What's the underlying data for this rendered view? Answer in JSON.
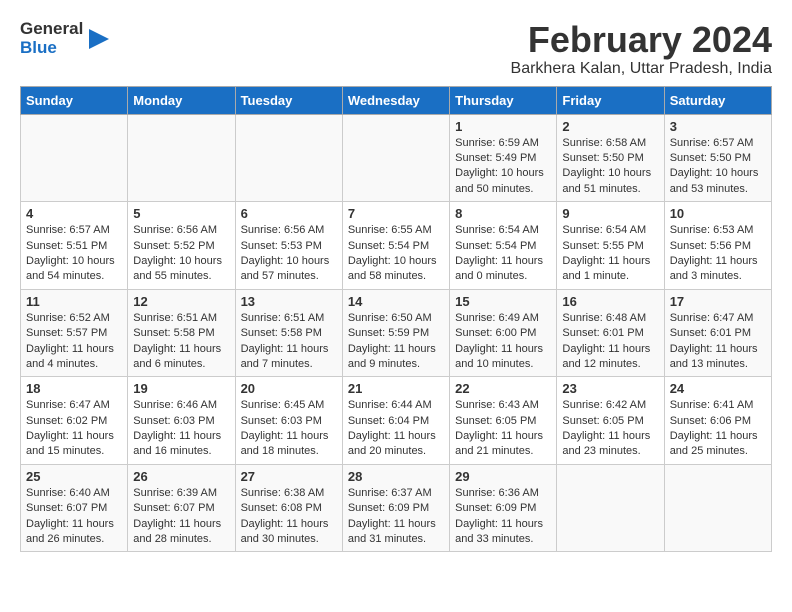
{
  "logo": {
    "line1": "General",
    "line2": "Blue"
  },
  "title": "February 2024",
  "subtitle": "Barkhera Kalan, Uttar Pradesh, India",
  "headers": [
    "Sunday",
    "Monday",
    "Tuesday",
    "Wednesday",
    "Thursday",
    "Friday",
    "Saturday"
  ],
  "rows": [
    [
      {
        "day": "",
        "info": ""
      },
      {
        "day": "",
        "info": ""
      },
      {
        "day": "",
        "info": ""
      },
      {
        "day": "",
        "info": ""
      },
      {
        "day": "1",
        "info": "Sunrise: 6:59 AM\nSunset: 5:49 PM\nDaylight: 10 hours\nand 50 minutes."
      },
      {
        "day": "2",
        "info": "Sunrise: 6:58 AM\nSunset: 5:50 PM\nDaylight: 10 hours\nand 51 minutes."
      },
      {
        "day": "3",
        "info": "Sunrise: 6:57 AM\nSunset: 5:50 PM\nDaylight: 10 hours\nand 53 minutes."
      }
    ],
    [
      {
        "day": "4",
        "info": "Sunrise: 6:57 AM\nSunset: 5:51 PM\nDaylight: 10 hours\nand 54 minutes."
      },
      {
        "day": "5",
        "info": "Sunrise: 6:56 AM\nSunset: 5:52 PM\nDaylight: 10 hours\nand 55 minutes."
      },
      {
        "day": "6",
        "info": "Sunrise: 6:56 AM\nSunset: 5:53 PM\nDaylight: 10 hours\nand 57 minutes."
      },
      {
        "day": "7",
        "info": "Sunrise: 6:55 AM\nSunset: 5:54 PM\nDaylight: 10 hours\nand 58 minutes."
      },
      {
        "day": "8",
        "info": "Sunrise: 6:54 AM\nSunset: 5:54 PM\nDaylight: 11 hours\nand 0 minutes."
      },
      {
        "day": "9",
        "info": "Sunrise: 6:54 AM\nSunset: 5:55 PM\nDaylight: 11 hours\nand 1 minute."
      },
      {
        "day": "10",
        "info": "Sunrise: 6:53 AM\nSunset: 5:56 PM\nDaylight: 11 hours\nand 3 minutes."
      }
    ],
    [
      {
        "day": "11",
        "info": "Sunrise: 6:52 AM\nSunset: 5:57 PM\nDaylight: 11 hours\nand 4 minutes."
      },
      {
        "day": "12",
        "info": "Sunrise: 6:51 AM\nSunset: 5:58 PM\nDaylight: 11 hours\nand 6 minutes."
      },
      {
        "day": "13",
        "info": "Sunrise: 6:51 AM\nSunset: 5:58 PM\nDaylight: 11 hours\nand 7 minutes."
      },
      {
        "day": "14",
        "info": "Sunrise: 6:50 AM\nSunset: 5:59 PM\nDaylight: 11 hours\nand 9 minutes."
      },
      {
        "day": "15",
        "info": "Sunrise: 6:49 AM\nSunset: 6:00 PM\nDaylight: 11 hours\nand 10 minutes."
      },
      {
        "day": "16",
        "info": "Sunrise: 6:48 AM\nSunset: 6:01 PM\nDaylight: 11 hours\nand 12 minutes."
      },
      {
        "day": "17",
        "info": "Sunrise: 6:47 AM\nSunset: 6:01 PM\nDaylight: 11 hours\nand 13 minutes."
      }
    ],
    [
      {
        "day": "18",
        "info": "Sunrise: 6:47 AM\nSunset: 6:02 PM\nDaylight: 11 hours\nand 15 minutes."
      },
      {
        "day": "19",
        "info": "Sunrise: 6:46 AM\nSunset: 6:03 PM\nDaylight: 11 hours\nand 16 minutes."
      },
      {
        "day": "20",
        "info": "Sunrise: 6:45 AM\nSunset: 6:03 PM\nDaylight: 11 hours\nand 18 minutes."
      },
      {
        "day": "21",
        "info": "Sunrise: 6:44 AM\nSunset: 6:04 PM\nDaylight: 11 hours\nand 20 minutes."
      },
      {
        "day": "22",
        "info": "Sunrise: 6:43 AM\nSunset: 6:05 PM\nDaylight: 11 hours\nand 21 minutes."
      },
      {
        "day": "23",
        "info": "Sunrise: 6:42 AM\nSunset: 6:05 PM\nDaylight: 11 hours\nand 23 minutes."
      },
      {
        "day": "24",
        "info": "Sunrise: 6:41 AM\nSunset: 6:06 PM\nDaylight: 11 hours\nand 25 minutes."
      }
    ],
    [
      {
        "day": "25",
        "info": "Sunrise: 6:40 AM\nSunset: 6:07 PM\nDaylight: 11 hours\nand 26 minutes."
      },
      {
        "day": "26",
        "info": "Sunrise: 6:39 AM\nSunset: 6:07 PM\nDaylight: 11 hours\nand 28 minutes."
      },
      {
        "day": "27",
        "info": "Sunrise: 6:38 AM\nSunset: 6:08 PM\nDaylight: 11 hours\nand 30 minutes."
      },
      {
        "day": "28",
        "info": "Sunrise: 6:37 AM\nSunset: 6:09 PM\nDaylight: 11 hours\nand 31 minutes."
      },
      {
        "day": "29",
        "info": "Sunrise: 6:36 AM\nSunset: 6:09 PM\nDaylight: 11 hours\nand 33 minutes."
      },
      {
        "day": "",
        "info": ""
      },
      {
        "day": "",
        "info": ""
      }
    ]
  ]
}
